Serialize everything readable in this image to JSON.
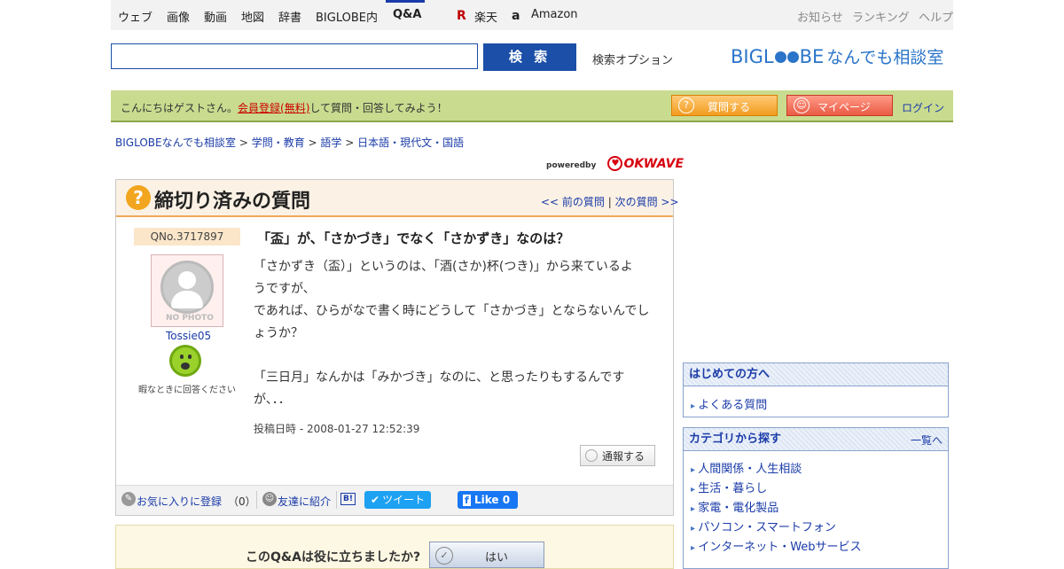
{
  "topnav": {
    "items": [
      "ウェブ",
      "画像",
      "動画",
      "地図",
      "辞書",
      "BIGLOBE内",
      "Q&A"
    ],
    "rakuten": "楽天",
    "amazon": "Amazon",
    "right": [
      "お知らせ",
      "ランキング",
      "ヘルプ"
    ]
  },
  "search": {
    "button": "検 索",
    "options": "検索オプション",
    "placeholder": ""
  },
  "logo": {
    "biglobe": "BIGL",
    "be": "BE",
    "suffix": "なんでも相談室"
  },
  "greenbar": {
    "pre": "こんにちはゲストさん。",
    "register": "会員登録(無料)",
    "post": "して質問・回答してみよう！",
    "ask": "質問する",
    "mypage": "マイページ",
    "login": "ログイン"
  },
  "breadcrumb": [
    "BIGLOBEなんでも相談室",
    "学問・教育",
    "語学",
    "日本語・現代文・国語"
  ],
  "powered": {
    "by": "poweredby",
    "brand": "OKWAVE"
  },
  "question": {
    "heading": "締切り済みの質問",
    "prev": "<< 前の質問",
    "next": "次の質問 >>",
    "no": "QNo.3717897",
    "user": "Tossie05",
    "nophoto": "NO PHOTO",
    "status": "暇なときに回答ください",
    "title": "「盃」が、「さかづき」でなく「さかずき」なのは？",
    "body": [
      "「さかずき（盃）」というのは、「酒(さか)杯(つき)」から来ているよ",
      "うですが、",
      "であれば、ひらがなで書く時にどうして「さかづき」とならないんでし",
      "ょうか？",
      "",
      "「三日月」なんかは「みかづき」なのに、と思ったりもするんですが、．．"
    ],
    "posted": "投稿日時 - 2008-01-27 12:52:39",
    "report": "通報する"
  },
  "actions": {
    "fav": "お気に入りに登録",
    "fav_count": "（0）",
    "share": "友達に紹介",
    "tweet": "ツイート",
    "like": "Like",
    "like_count": "0"
  },
  "helpful": {
    "question": "このQ&Aは役に立ちましたか?",
    "yes": "はい"
  },
  "side": {
    "first_title": "はじめての方へ",
    "faq": "よくある質問",
    "cat_title": "カテゴリから探す",
    "cat_all": "一覧へ",
    "cats": [
      "人間関係・人生相談",
      "生活・暮らし",
      "家電・電化製品",
      "パソコン・スマートフォン",
      "インターネット・Webサービス"
    ]
  }
}
